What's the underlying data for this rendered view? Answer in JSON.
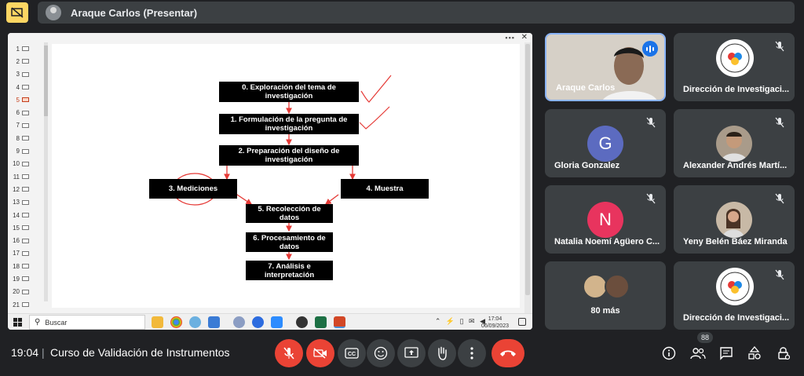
{
  "header": {
    "presenter_title": "Araque Carlos (Presentar)"
  },
  "slide": {
    "thumbnail_numbers": [
      "1",
      "2",
      "3",
      "4",
      "5",
      "6",
      "7",
      "8",
      "9",
      "10",
      "11",
      "12",
      "13",
      "14",
      "15",
      "16",
      "17",
      "18",
      "19",
      "20",
      "21"
    ],
    "active_slide": "5",
    "boxes": {
      "b0": "0. Exploración del tema de investigación",
      "b1": "1. Formulación de la pregunta de investigación",
      "b2": "2. Preparación del diseño de investigación",
      "b3": "3. Mediciones",
      "b4": "4. Muestra",
      "b5": "5. Recolección de datos",
      "b6": "6. Procesamiento de datos",
      "b7": "7. Análisis e interpretación"
    }
  },
  "taskbar": {
    "search_label": "Buscar",
    "time": "17:04",
    "date": "06/09/2023"
  },
  "participants": [
    {
      "name": "Araque Carlos"
    },
    {
      "name": "Dirección de Investigaci..."
    },
    {
      "name": "Gloria Gonzalez",
      "initial": "G"
    },
    {
      "name": "Alexander Andrés Martí..."
    },
    {
      "name": "Natalia Noemí Agüero C...",
      "initial": "N"
    },
    {
      "name": "Yeny Belén Báez Miranda"
    },
    {
      "name": "80 más"
    },
    {
      "name": "Dirección de Investigaci..."
    }
  ],
  "colors": {
    "gloria_avatar": "#5c6bc0",
    "natalia_avatar": "#e8345e",
    "hangup": "#ea4335",
    "highlight": "#8ab4f8"
  },
  "bottom": {
    "time": "19:04",
    "separator": "|",
    "meeting_title": "Curso de Validación de Instrumentos",
    "people_count": "88"
  },
  "icons": [
    "present-off-icon",
    "mic-off-icon",
    "camera-off-icon",
    "captions-icon",
    "emoji-icon",
    "present-icon",
    "raise-hand-icon",
    "more-options-icon",
    "hang-up-icon",
    "info-icon",
    "people-icon",
    "chat-icon",
    "activities-icon",
    "lock-icon"
  ]
}
